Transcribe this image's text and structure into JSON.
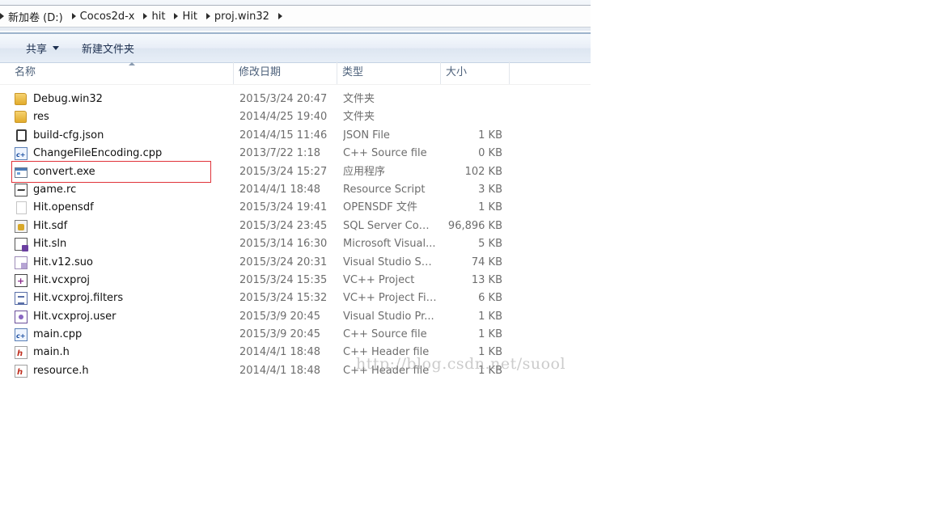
{
  "breadcrumb": [
    "新加卷 (D:)",
    "Cocos2d-x",
    "hit",
    "Hit",
    "proj.win32"
  ],
  "toolbar": {
    "share_label": "共享",
    "new_folder_label": "新建文件夹"
  },
  "columns": {
    "name": "名称",
    "date": "修改日期",
    "type": "类型",
    "size": "大小"
  },
  "files": [
    {
      "name": "Debug.win32",
      "date": "2015/3/24 20:47",
      "type": "文件夹",
      "size": "",
      "icon": "folder-icon"
    },
    {
      "name": "res",
      "date": "2014/4/25 19:40",
      "type": "文件夹",
      "size": "",
      "icon": "folder-icon"
    },
    {
      "name": "build-cfg.json",
      "date": "2014/4/15 11:46",
      "type": "JSON File",
      "size": "1 KB",
      "icon": "json-file-icon"
    },
    {
      "name": "ChangeFileEncoding.cpp",
      "date": "2013/7/22 1:18",
      "type": "C++ Source file",
      "size": "0 KB",
      "icon": "cpp-file-icon"
    },
    {
      "name": "convert.exe",
      "date": "2015/3/24 15:27",
      "type": "应用程序",
      "size": "102 KB",
      "icon": "exe-file-icon"
    },
    {
      "name": "game.rc",
      "date": "2014/4/1 18:48",
      "type": "Resource Script",
      "size": "3 KB",
      "icon": "resource-script-icon"
    },
    {
      "name": "Hit.opensdf",
      "date": "2015/3/24 19:41",
      "type": "OPENSDF 文件",
      "size": "1 KB",
      "icon": "blank-file-icon"
    },
    {
      "name": "Hit.sdf",
      "date": "2015/3/24 23:45",
      "type": "SQL Server Com...",
      "size": "96,896 KB",
      "icon": "sql-database-icon"
    },
    {
      "name": "Hit.sln",
      "date": "2015/3/14 16:30",
      "type": "Microsoft Visual...",
      "size": "5 KB",
      "icon": "visual-studio-solution-icon"
    },
    {
      "name": "Hit.v12.suo",
      "date": "2015/3/24 20:31",
      "type": "Visual Studio Sol...",
      "size": "74 KB",
      "icon": "visual-studio-suo-icon"
    },
    {
      "name": "Hit.vcxproj",
      "date": "2015/3/24 15:35",
      "type": "VC++ Project",
      "size": "13 KB",
      "icon": "vcxproj-file-icon"
    },
    {
      "name": "Hit.vcxproj.filters",
      "date": "2015/3/24 15:32",
      "type": "VC++ Project Fil...",
      "size": "6 KB",
      "icon": "vcxproj-filters-icon"
    },
    {
      "name": "Hit.vcxproj.user",
      "date": "2015/3/9 20:45",
      "type": "Visual Studio Pr...",
      "size": "1 KB",
      "icon": "vcxproj-user-icon"
    },
    {
      "name": "main.cpp",
      "date": "2015/3/9 20:45",
      "type": "C++ Source file",
      "size": "1 KB",
      "icon": "cpp-file-icon"
    },
    {
      "name": "main.h",
      "date": "2014/4/1 18:48",
      "type": "C++ Header file",
      "size": "1 KB",
      "icon": "header-file-icon"
    },
    {
      "name": "resource.h",
      "date": "2014/4/1 18:48",
      "type": "C++ Header file",
      "size": "1 KB",
      "icon": "header-file-icon"
    }
  ],
  "highlighted_file": "convert.exe",
  "highlight_color": "#e0333a",
  "watermark": "http://blog.csdn.net/suool"
}
